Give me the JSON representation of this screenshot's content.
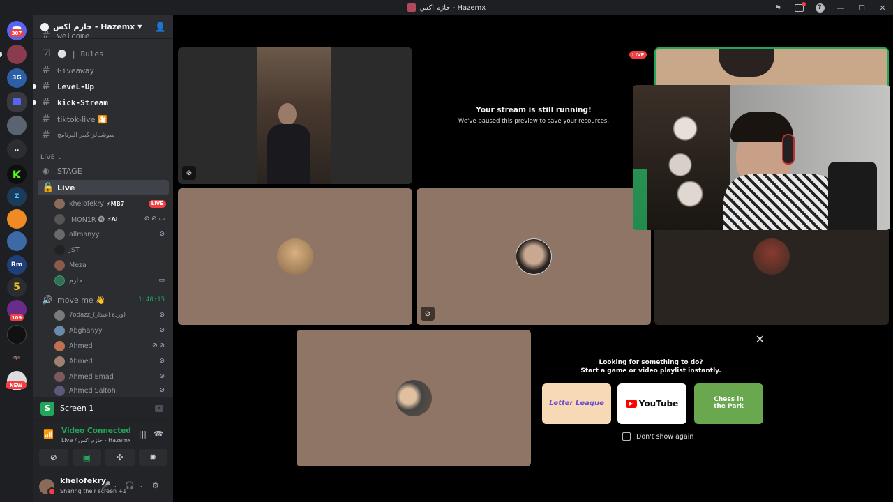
{
  "window": {
    "title": "حازم اكس - Hazemx"
  },
  "rail": {
    "dm_badge": "307",
    "servers": [
      {
        "name": "server-avatar-1",
        "color": "#8a3b4e"
      },
      {
        "name": "server-3g",
        "label": "3G",
        "color": "#2b5fa8"
      },
      {
        "name": "server-folder",
        "color": "#5865f2"
      },
      {
        "name": "server-landscape",
        "color": "#5a6470"
      },
      {
        "name": "server-dots",
        "label": "..",
        "color": "#2b2d31"
      },
      {
        "name": "server-kick",
        "label": "K",
        "color": "#0f0f0f"
      },
      {
        "name": "server-z",
        "label": "Z",
        "color": "#1a3c5a"
      },
      {
        "name": "server-orange",
        "color": "#f08a24"
      },
      {
        "name": "server-blue",
        "color": "#3d6aa6"
      },
      {
        "name": "server-rm",
        "label": "Rm",
        "color": "#1f3f7a"
      },
      {
        "name": "server-5",
        "label": "5",
        "color": "#2b2d31"
      },
      {
        "name": "server-purple",
        "color": "#6a2b8a"
      },
      {
        "name": "server-black",
        "color": "#111"
      },
      {
        "name": "server-bat",
        "color": "#1e1f22"
      },
      {
        "name": "server-new",
        "color": "#ddd"
      }
    ],
    "badge_109": "109",
    "badge_new": "NEW"
  },
  "guild": {
    "name": "حازم اكس - Hazemx"
  },
  "channels": {
    "text": [
      {
        "label": "welcome",
        "style": "dim"
      },
      {
        "label": "⚪ | Rules",
        "style": "dim"
      },
      {
        "label": "Giveaway",
        "style": "dim"
      },
      {
        "label": "LeveL-Up",
        "style": "bright"
      },
      {
        "label": "kick-Stream",
        "style": "bright"
      },
      {
        "label": "tiktok-live 🎦",
        "style": "dim"
      },
      {
        "label": "سوشيالز-كبير البرنامج",
        "style": "dim"
      }
    ],
    "category": "LIVE",
    "stage": "STAGE",
    "live_channel": "Live",
    "live_members": [
      {
        "name": "khelofekry",
        "tag": "⚡MB7",
        "live": "LIVE",
        "color": "#8a6a5a"
      },
      {
        "name": ".MON1R 🅐",
        "tag": "⚡AI",
        "icons": "🔇🎧📷",
        "color": "#555"
      },
      {
        "name": "allmanyy",
        "icons": "🔇",
        "color": "#6a6a6a"
      },
      {
        "name": "J$T",
        "color": "#222"
      },
      {
        "name": "Meza",
        "color": "#8a5a4a"
      },
      {
        "name": "حازم",
        "icons": "📷",
        "color": "#3a6a5a"
      }
    ],
    "move_me": {
      "label": "move me 👋",
      "timer": "1:48:15"
    },
    "move_members": [
      {
        "name": "7odazz_(وردة اعتذار)",
        "icons": "🔇",
        "color": "#7a7a7a"
      },
      {
        "name": "Abghanyy",
        "icons": "🔇",
        "color": "#6a8aaa"
      },
      {
        "name": "Ahmed",
        "icons": "🔇🎧",
        "color": "#c07050"
      },
      {
        "name": "Ahmed",
        "icons": "🔇",
        "color": "#a08070"
      },
      {
        "name": "Ahmed Emad",
        "icons": "🔇",
        "color": "#7a5a5a"
      },
      {
        "name": "Ahmed Saltoh",
        "icons": "🔇",
        "color": "#5a5a7a"
      }
    ]
  },
  "panel": {
    "screen_label": "Screen 1",
    "video_connected": "Video Connected",
    "video_sub": "Live / حازم اكس - Hazemx",
    "username": "khelofekry",
    "status": "Sharing their screen +1"
  },
  "stage": {
    "paused_title": "Your stream is still running!",
    "paused_sub": "We've paused this preview to save your resources.",
    "live_badge": "LIVE",
    "tile_colors": {
      "tile_bg": "#8e7565",
      "tile_dark": "#2a2420"
    },
    "activity": {
      "line1": "Looking for something to do?",
      "line2": "Start a game or video playlist instantly.",
      "cards": [
        {
          "label": "Letter League",
          "color": "#f7d9b5"
        },
        {
          "label": "YouTube",
          "color": "#ffffff"
        },
        {
          "label": "Chess in the Park",
          "color": "#6aa84f"
        }
      ],
      "dont_show": "Don't show again"
    }
  }
}
